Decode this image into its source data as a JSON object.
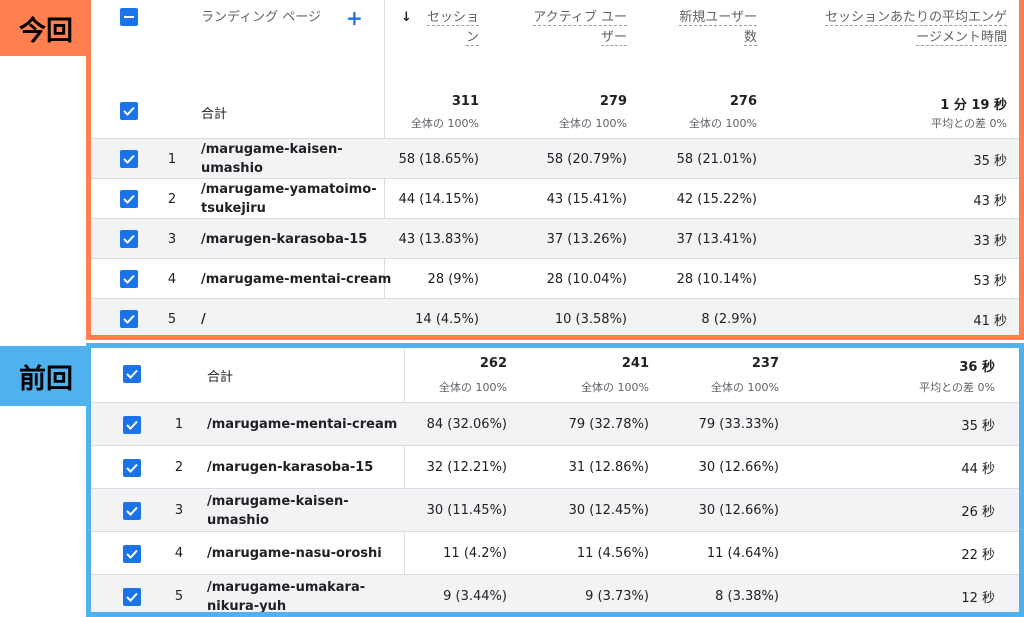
{
  "labels": {
    "current": "今回",
    "previous": "前回"
  },
  "colors": {
    "current": "#ff7f50",
    "previous": "#4fb2ee",
    "checkbox": "#1a73e8"
  },
  "header": {
    "landing_page": "ランディング ページ",
    "add": "+",
    "sort_arrow": "↓",
    "sessions_l1": "セッショ",
    "sessions_l2": "ン",
    "active_l1": "アクティブ ユー",
    "active_l2": "ザー",
    "new_l1": "新規ユーザー",
    "new_l2": "数",
    "eng_l1": "セッションあたりの平均エンゲ",
    "eng_l2": "ージメント時間"
  },
  "current": {
    "total": {
      "label": "合計",
      "sessions": "311",
      "sessions_sub": "全体の 100%",
      "active": "279",
      "active_sub": "全体の 100%",
      "new": "276",
      "new_sub": "全体の 100%",
      "eng": "1 分 19 秒",
      "eng_sub": "平均との差 0%"
    },
    "rows": [
      {
        "idx": "1",
        "page_l1": "/marugame-kaisen-",
        "page_l2": "umashio",
        "sessions": "58 (18.65%)",
        "active": "58 (20.79%)",
        "new": "58 (21.01%)",
        "eng": "35 秒"
      },
      {
        "idx": "2",
        "page_l1": "/marugame-yamatoimo-",
        "page_l2": "tsukejiru",
        "sessions": "44 (14.15%)",
        "active": "43 (15.41%)",
        "new": "42 (15.22%)",
        "eng": "43 秒"
      },
      {
        "idx": "3",
        "page_l1": "/marugen-karasoba-15",
        "page_l2": "",
        "sessions": "43 (13.83%)",
        "active": "37 (13.26%)",
        "new": "37 (13.41%)",
        "eng": "33 秒"
      },
      {
        "idx": "4",
        "page_l1": "/marugame-mentai-cream",
        "page_l2": "",
        "sessions": "28 (9%)",
        "active": "28 (10.04%)",
        "new": "28 (10.14%)",
        "eng": "53 秒"
      },
      {
        "idx": "5",
        "page_l1": "/",
        "page_l2": "",
        "sessions": "14 (4.5%)",
        "active": "10 (3.58%)",
        "new": "8 (2.9%)",
        "eng": "41 秒"
      }
    ]
  },
  "previous": {
    "total": {
      "label": "合計",
      "sessions": "262",
      "sessions_sub": "全体の 100%",
      "active": "241",
      "active_sub": "全体の 100%",
      "new": "237",
      "new_sub": "全体の 100%",
      "eng": "36 秒",
      "eng_sub": "平均との差 0%"
    },
    "rows": [
      {
        "idx": "1",
        "page_l1": "/marugame-mentai-cream",
        "page_l2": "",
        "sessions": "84 (32.06%)",
        "active": "79 (32.78%)",
        "new": "79 (33.33%)",
        "eng": "35 秒"
      },
      {
        "idx": "2",
        "page_l1": "/marugen-karasoba-15",
        "page_l2": "",
        "sessions": "32 (12.21%)",
        "active": "31 (12.86%)",
        "new": "30 (12.66%)",
        "eng": "44 秒"
      },
      {
        "idx": "3",
        "page_l1": "/marugame-kaisen-",
        "page_l2": "umashio",
        "sessions": "30 (11.45%)",
        "active": "30 (12.45%)",
        "new": "30 (12.66%)",
        "eng": "26 秒"
      },
      {
        "idx": "4",
        "page_l1": "/marugame-nasu-oroshi",
        "page_l2": "",
        "sessions": "11 (4.2%)",
        "active": "11 (4.56%)",
        "new": "11 (4.64%)",
        "eng": "22 秒"
      },
      {
        "idx": "5",
        "page_l1": "/marugame-umakara-",
        "page_l2": "nikura-yuh",
        "sessions": "9 (3.44%)",
        "active": "9 (3.73%)",
        "new": "8 (3.38%)",
        "eng": "12 秒"
      }
    ]
  }
}
